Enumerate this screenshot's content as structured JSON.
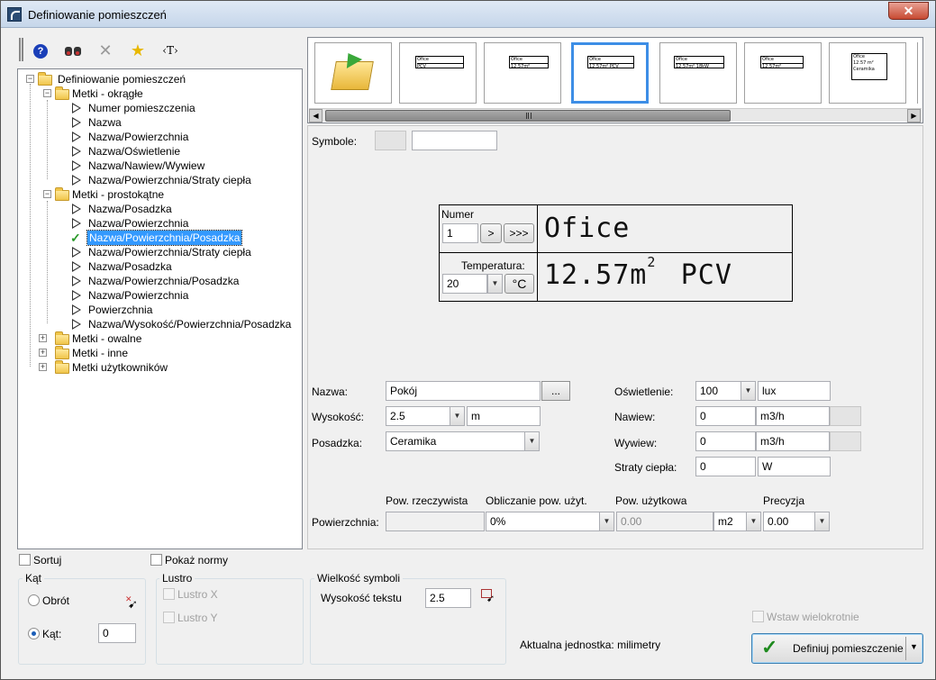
{
  "window": {
    "title": "Definiowanie pomieszczeń",
    "close_glyph": "✕"
  },
  "toolbar": {
    "help_icon": "help-icon",
    "find_icon": "binoculars-icon",
    "delete_icon": "delete-icon",
    "favorite_icon": "star-icon",
    "text_tag": "‹T›"
  },
  "tree": {
    "root": "Definiowanie pomieszczeń",
    "groups": [
      {
        "label": "Metki - okrągłe",
        "items": [
          "Numer pomieszczenia",
          "Nazwa",
          "Nazwa/Powierzchnia",
          "Nazwa/Oświetlenie",
          "Nazwa/Nawiew/Wywiew",
          "Nazwa/Powierzchnia/Straty ciepła"
        ]
      },
      {
        "label": "Metki - prostokątne",
        "items": [
          "Nazwa/Posadzka",
          "Nazwa/Powierzchnia",
          "Nazwa/Powierzchnia/Posadzka",
          "Nazwa/Powierzchnia/Straty ciepła",
          "Nazwa/Posadzka",
          "Nazwa/Powierzchnia/Posadzka",
          "Nazwa/Powierzchnia",
          "Powierzchnia",
          "Nazwa/Wysokość/Powierzchnia/Posadzka"
        ]
      },
      {
        "label": "Metki - owalne"
      },
      {
        "label": "Metki - inne"
      },
      {
        "label": "Metki użytkowników"
      }
    ]
  },
  "thumbnails": [
    {
      "lines": [
        "Ofice",
        "PCV"
      ]
    },
    {
      "lines": [
        "Ofice",
        "12.57m²"
      ]
    },
    {
      "lines": [
        "Ofice",
        "12.57m² PCV"
      ]
    },
    {
      "lines": [
        "Ofice",
        "12.57m² 18kW"
      ]
    },
    {
      "lines": [
        "Ofice",
        "12.57m²"
      ]
    },
    {
      "lines": [
        "Ofice",
        "12.57 m²",
        "Ceramika"
      ]
    }
  ],
  "symbols": {
    "label": "Symbole:"
  },
  "preview": {
    "numer_label": "Numer",
    "numer_value": "1",
    "next_btn": ">",
    "last_btn": ">>>",
    "temp_label": "Temperatura:",
    "temp_value": "20",
    "temp_unit": "°C",
    "name_text": "Ofice",
    "area_text": "12.57m",
    "area_sup": "2",
    "floor_text": "PCV"
  },
  "form": {
    "nazwa_label": "Nazwa:",
    "nazwa_value": "Pokój",
    "browse_btn": "...",
    "wysokosc_label": "Wysokość:",
    "wysokosc_value": "2.5",
    "wysokosc_unit": "m",
    "posadzka_label": "Posadzka:",
    "posadzka_value": "Ceramika",
    "oswietlenie_label": "Oświetlenie:",
    "oswietlenie_value": "100",
    "oswietlenie_unit": "lux",
    "nawiew_label": "Nawiew:",
    "nawiew_value": "0",
    "nawiew_unit": "m3/h",
    "wywiew_label": "Wywiew:",
    "wywiew_value": "0",
    "wywiew_unit": "m3/h",
    "straty_label": "Straty ciepła:",
    "straty_value": "0",
    "straty_unit": "W"
  },
  "surface": {
    "label": "Powierzchnia:",
    "col_real": "Pow. rzeczywista",
    "col_calc": "Obliczanie pow. użyt.",
    "col_usable": "Pow. użytkowa",
    "col_precision": "Precyzja",
    "calc_value": "0%",
    "usable_value": "0.00",
    "unit_value": "m2",
    "precision_value": "0.00"
  },
  "bottom": {
    "sort_label": "Sortuj",
    "norms_label": "Pokaż normy",
    "angle_group": "Kąt",
    "rotation_label": "Obrót",
    "angle_label": "Kąt:",
    "angle_value": "0",
    "mirror_group": "Lustro",
    "mirror_x": "Lustro X",
    "mirror_y": "Lustro Y",
    "size_group": "Wielkość symboli",
    "text_height_label": "Wysokość tekstu",
    "text_height_value": "2.5",
    "multi_insert_label": "Wstaw wielokrotnie",
    "unit_info": "Aktualna jednostka: milimetry",
    "define_btn": "Definiuj pomieszczenie"
  }
}
